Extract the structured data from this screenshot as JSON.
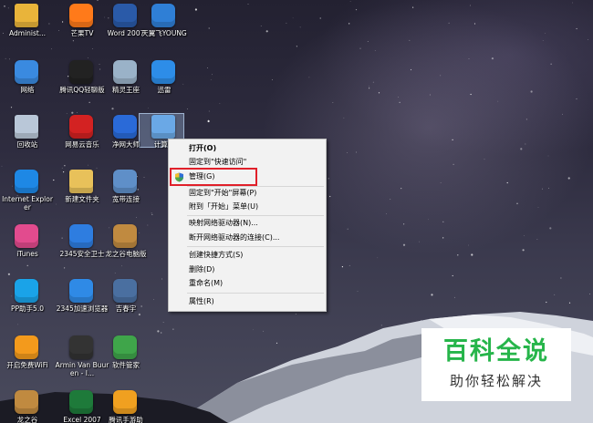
{
  "desktop_icons": [
    {
      "label": "Administ...",
      "icon": "user-folder-icon"
    },
    {
      "label": "芒果TV",
      "icon": "mango-tv-icon"
    },
    {
      "label": "Word 2007",
      "icon": "word-icon"
    },
    {
      "label": "天翼飞YOUNG",
      "icon": "tianyi-icon"
    },
    {
      "label": "网络",
      "icon": "network-icon"
    },
    {
      "label": "腾讯QQ轻聊版",
      "icon": "qq-icon"
    },
    {
      "label": "精灵王座",
      "icon": "game-icon"
    },
    {
      "label": "迅雷",
      "icon": "xunlei-icon"
    },
    {
      "label": "回收站",
      "icon": "recycle-bin-icon"
    },
    {
      "label": "网易云音乐",
      "icon": "netease-music-icon"
    },
    {
      "label": "净网大师",
      "icon": "shield-a-icon"
    },
    {
      "label": "计算机",
      "icon": "computer-icon"
    },
    {
      "label": "Internet Explorer",
      "icon": "ie-icon"
    },
    {
      "label": "新建文件夹",
      "icon": "folder-icon"
    },
    {
      "label": "宽带连接",
      "icon": "broadband-icon"
    },
    {
      "label": "iTunes",
      "icon": "itunes-icon"
    },
    {
      "label": "2345安全卫士",
      "icon": "security-shield-icon"
    },
    {
      "label": "龙之谷电脑版",
      "icon": "dragon-nest-icon"
    },
    {
      "label": "PP助手5.0",
      "icon": "pp-assistant-icon"
    },
    {
      "label": "2345加速浏览器",
      "icon": "browser-icon"
    },
    {
      "label": "吉春宇",
      "icon": "photo-icon"
    },
    {
      "label": "开启免费WiFi",
      "icon": "wifi-icon"
    },
    {
      "label": "Armin Van Buuren - I...",
      "icon": "album-icon"
    },
    {
      "label": "软件管家",
      "icon": "software-manager-icon"
    },
    {
      "label": "龙之谷",
      "icon": "dragon-nest-icon"
    },
    {
      "label": "Excel 2007",
      "icon": "excel-icon"
    },
    {
      "label": "腾讯手游助",
      "icon": "tencent-game-icon"
    }
  ],
  "context_menu": {
    "items": [
      {
        "label": "打开(O)",
        "bold": true
      },
      {
        "label": "固定到\"快速访问\""
      },
      {
        "label": "管理(G)",
        "shield": true
      },
      {
        "label": "固定到\"开始\"屏幕(P)"
      },
      {
        "label": "附到「开始」菜单(U)"
      },
      {
        "label": "映射网络驱动器(N)..."
      },
      {
        "label": "断开网络驱动器的连接(C)..."
      },
      {
        "label": "创建快捷方式(S)"
      },
      {
        "label": "删除(D)"
      },
      {
        "label": "重命名(M)"
      },
      {
        "label": "属性(R)"
      }
    ],
    "highlight_color": "#e0202a"
  },
  "watermark": {
    "title": "百科全说",
    "subtitle": "助你轻松解决",
    "title_color": "#26b54a"
  }
}
